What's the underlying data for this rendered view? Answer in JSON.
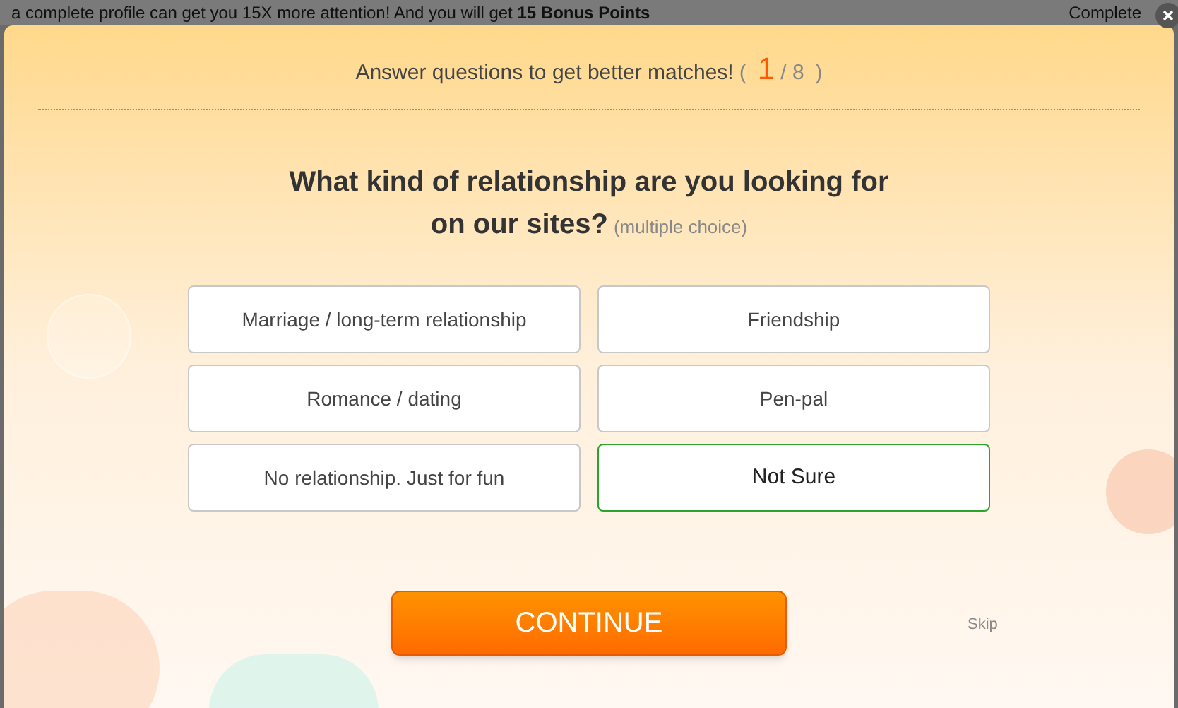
{
  "background_page": {
    "notice": "a complete profile can get you 15X more attention! And you will get **15 Bonus Points**",
    "side_link": "Complete"
  },
  "dialog": {
    "progress_text": "Answer questions to get better matches!",
    "progress_current": "1",
    "progress_paren_open": "(",
    "progress_total": "/ 8",
    "progress_paren_close": ")",
    "question_lines": [
      "What kind of relationship are you looking for",
      "on our sites?"
    ],
    "question_hint": "(multiple choice)",
    "options": [
      {
        "label": "Marriage / long-term relationship",
        "selected": false
      },
      {
        "label": "Friendship",
        "selected": false
      },
      {
        "label": "Romance / dating",
        "selected": false
      },
      {
        "label": "Pen-pal",
        "selected": false
      },
      {
        "label": "No relationship. Just for fun",
        "selected": false
      },
      {
        "label": "Not Sure",
        "selected": true
      }
    ],
    "continue_button": "CONTINUE",
    "skip_link": "Skip"
  }
}
